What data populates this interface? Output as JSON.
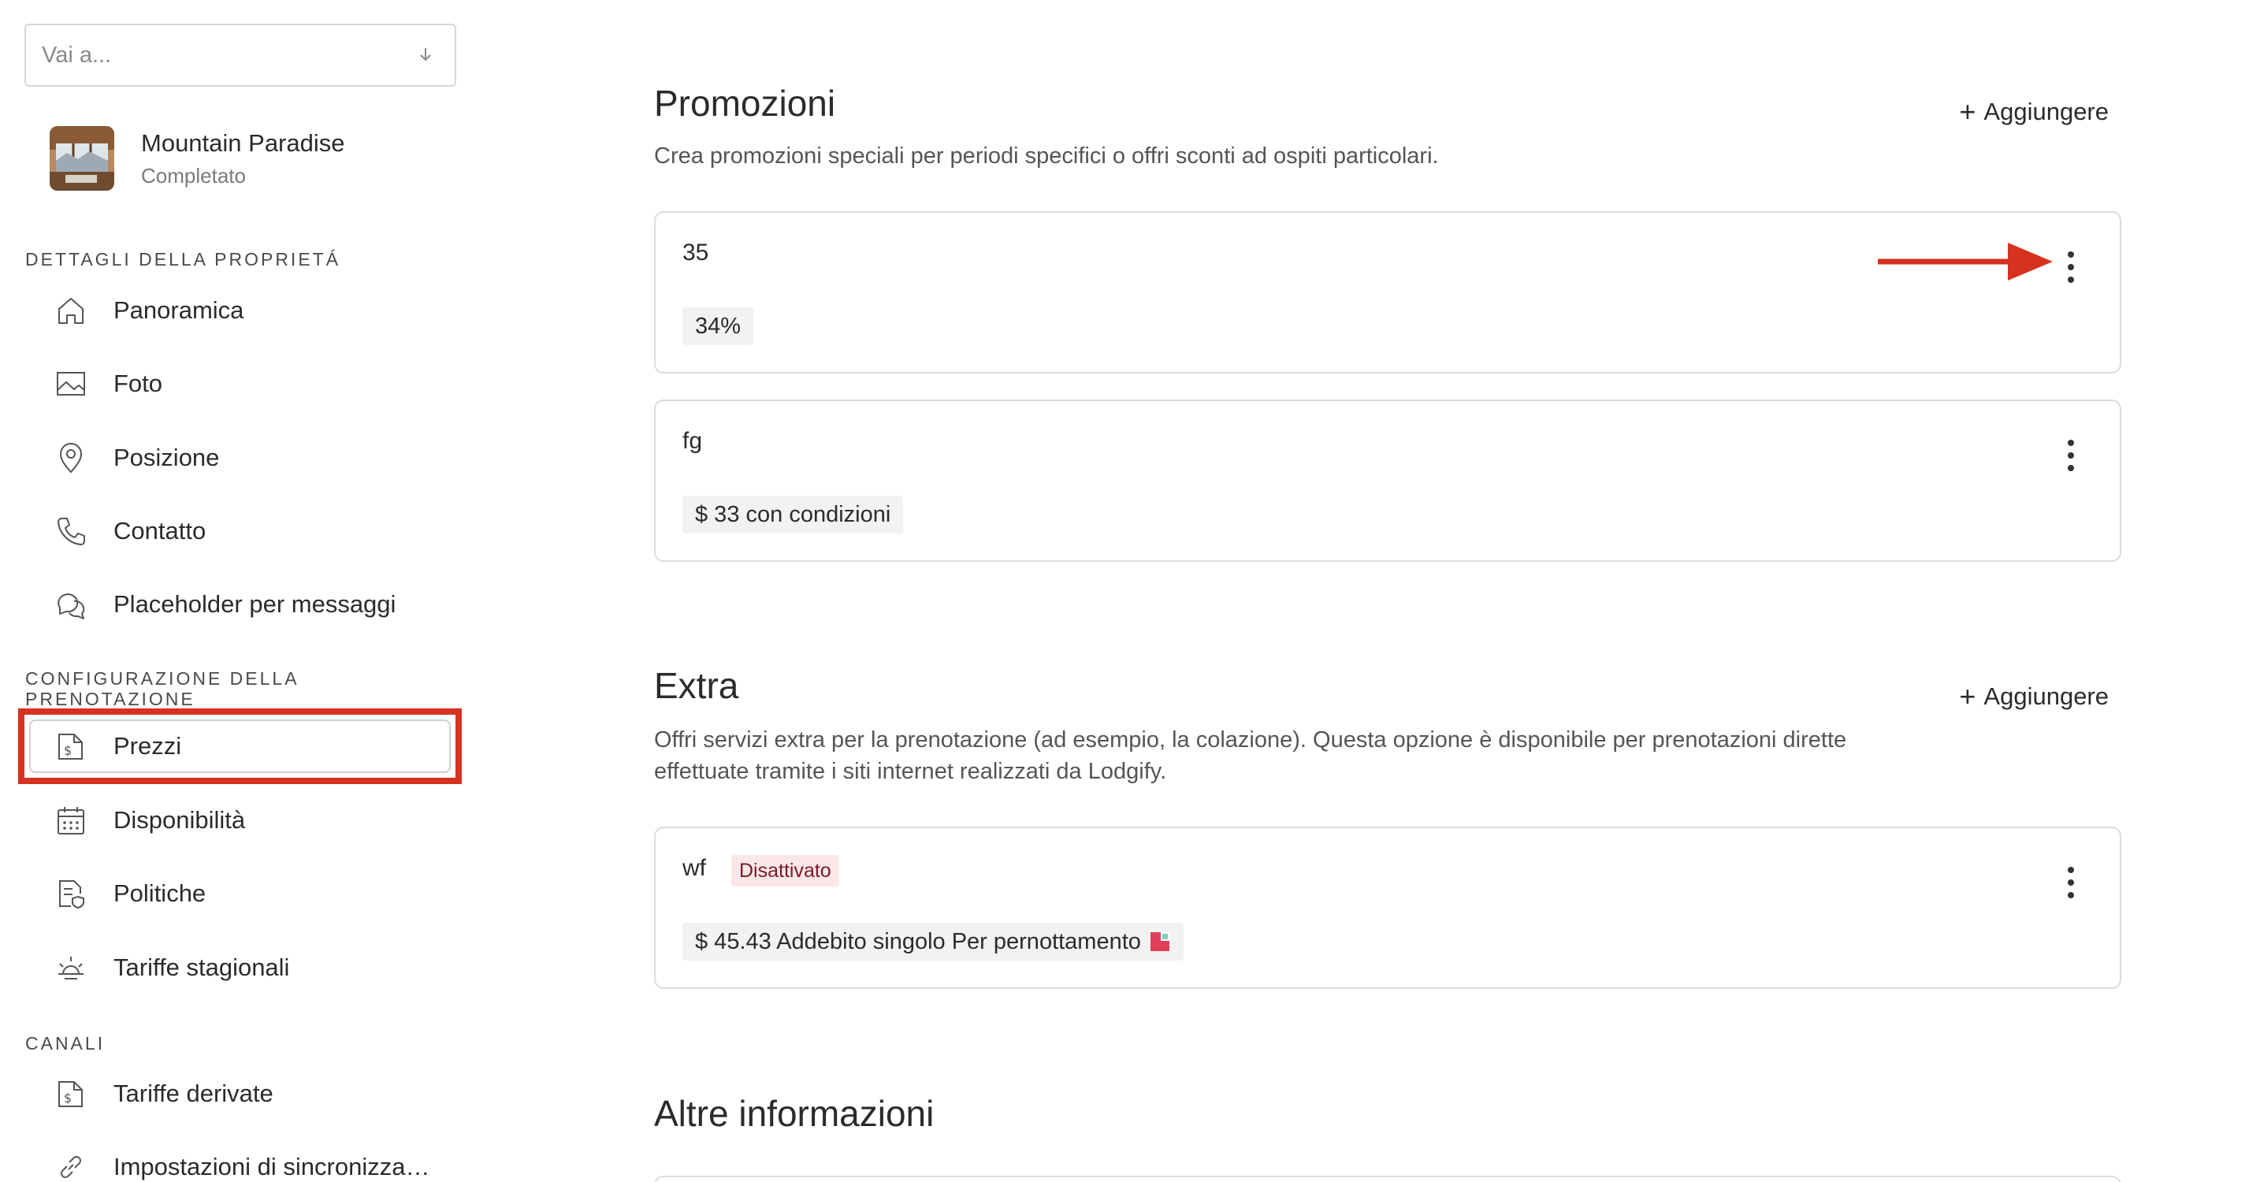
{
  "sidebar": {
    "goto_placeholder": "Vai a...",
    "property": {
      "name": "Mountain Paradise",
      "status": "Completato"
    },
    "sections": {
      "details": "DETTAGLI DELLA PROPRIETÁ",
      "booking_config_line1": "CONFIGURAZIONE DELLA",
      "booking_config_line2": "PRENOTAZIONE",
      "channels": "CANALI"
    },
    "items": {
      "overview": "Panoramica",
      "photos": "Foto",
      "location": "Posizione",
      "contact": "Contatto",
      "placeholders": "Placeholder per messaggi",
      "prices": "Prezzi",
      "availability": "Disponibilità",
      "policies": "Politiche",
      "seasonal": "Tariffe stagionali",
      "derived": "Tariffe derivate",
      "sync": "Impostazioni di sincronizza…"
    },
    "selected_item": "Prezzi"
  },
  "main": {
    "promotions": {
      "title": "Promozioni",
      "add_label": "Aggiungere",
      "description": "Crea promozioni speciali per periodi specifici o offri sconti ad ospiti particolari.",
      "cards": [
        {
          "title": "35",
          "chip": "34%"
        },
        {
          "title": "fg",
          "chip": "$ 33 con condizioni"
        }
      ]
    },
    "extra": {
      "title": "Extra",
      "add_label": "Aggiungere",
      "description_line1": "Offri servizi extra per la prenotazione (ad esempio, la colazione). Questa opzione è disponibile per prenotazioni dirette",
      "description_line2": "effettuate tramite i siti internet realizzati da Lodgify.",
      "cards": [
        {
          "title": "wf",
          "status": "Disattivato",
          "chip": "$ 45.43 Addebito singolo Per pernottamento"
        }
      ]
    },
    "other": {
      "title": "Altre informazioni"
    }
  },
  "colors": {
    "highlight_red": "#d6321f",
    "badge_bg": "#fbe7e9",
    "chip_bg": "#f2f2f2"
  }
}
